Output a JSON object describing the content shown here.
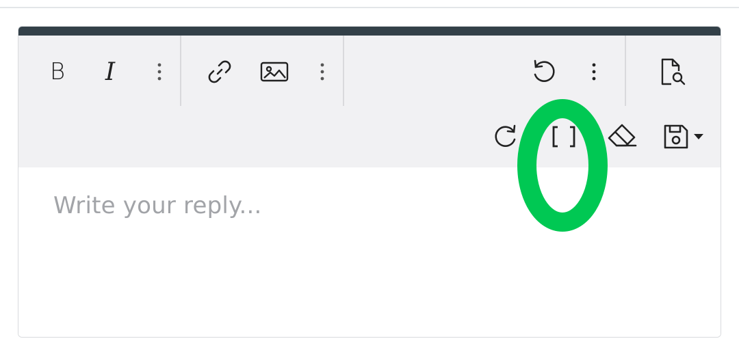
{
  "editor": {
    "placeholder": "Write your reply...",
    "accent_color": "#334048",
    "toolbar_bg": "#f1f1f3"
  },
  "toolbar": {
    "row1": [
      {
        "icon": "bold-icon",
        "label": "B"
      },
      {
        "icon": "italic-icon",
        "label": "I"
      },
      {
        "icon": "more-vertical-icon"
      },
      {
        "icon": "link-icon"
      },
      {
        "icon": "image-icon"
      },
      {
        "icon": "more-vertical-icon"
      },
      {
        "icon": "undo-icon"
      },
      {
        "icon": "more-vertical-icon"
      },
      {
        "icon": "preview-icon"
      }
    ],
    "row2": [
      {
        "icon": "redo-icon"
      },
      {
        "icon": "bbcode-brackets-icon"
      },
      {
        "icon": "eraser-icon"
      },
      {
        "icon": "save-draft-icon"
      },
      {
        "icon": "caret-down-icon"
      }
    ]
  },
  "annotation": {
    "color": "#00c853",
    "shape": "ellipse"
  }
}
